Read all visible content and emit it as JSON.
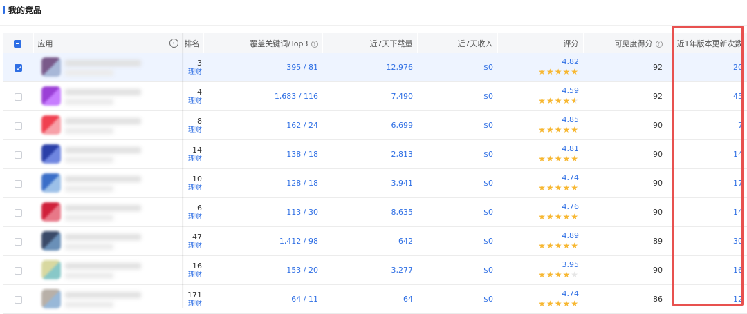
{
  "section": {
    "title": "我的竞品"
  },
  "columns": {
    "app": "应用",
    "rank": "排名",
    "keywords": "覆盖关键词/Top3",
    "downloads": "近7天下载量",
    "revenue": "近7天收入",
    "rating": "评分",
    "visibility": "可见度得分",
    "updates": "近1年版本更新次数"
  },
  "icons": {
    "collapse": "chevron-left-circle-icon",
    "help": "question-circle-icon",
    "star": "star-icon"
  },
  "colors": {
    "accent": "#2f6fe4",
    "star": "#f7b731",
    "highlight": "#e8514f"
  },
  "rows": [
    {
      "checked": true,
      "icon_colors": [
        "#7a5a8a",
        "#a8b8d8"
      ],
      "rank": "3",
      "category": "理财",
      "keywords": "395 / 81",
      "downloads": "12,976",
      "revenue": "$0",
      "rating": "4.82",
      "stars": 5,
      "visibility": "92",
      "updates": "20"
    },
    {
      "checked": false,
      "icon_colors": [
        "#9b3fd6",
        "#c77dff"
      ],
      "rank": "4",
      "category": "理财",
      "keywords": "1,683 / 116",
      "downloads": "7,490",
      "revenue": "$0",
      "rating": "4.59",
      "stars": 4.5,
      "visibility": "92",
      "updates": "45"
    },
    {
      "checked": false,
      "icon_colors": [
        "#f04050",
        "#f7a0a8"
      ],
      "rank": "8",
      "category": "理财",
      "keywords": "162 / 24",
      "downloads": "6,699",
      "revenue": "$0",
      "rating": "4.85",
      "stars": 5,
      "visibility": "90",
      "updates": "7"
    },
    {
      "checked": false,
      "icon_colors": [
        "#2a3fa8",
        "#6f86e0"
      ],
      "rank": "14",
      "category": "理财",
      "keywords": "138 / 18",
      "downloads": "2,813",
      "revenue": "$0",
      "rating": "4.81",
      "stars": 5,
      "visibility": "90",
      "updates": "14"
    },
    {
      "checked": false,
      "icon_colors": [
        "#3a6ec8",
        "#9cc0e8"
      ],
      "rank": "10",
      "category": "理财",
      "keywords": "128 / 18",
      "downloads": "3,941",
      "revenue": "$0",
      "rating": "4.74",
      "stars": 5,
      "visibility": "90",
      "updates": "17"
    },
    {
      "checked": false,
      "icon_colors": [
        "#d0203a",
        "#e87888"
      ],
      "rank": "6",
      "category": "理财",
      "keywords": "113 / 30",
      "downloads": "8,635",
      "revenue": "$0",
      "rating": "4.76",
      "stars": 5,
      "visibility": "90",
      "updates": "14"
    },
    {
      "checked": false,
      "icon_colors": [
        "#3a4a68",
        "#6a90b8"
      ],
      "rank": "47",
      "category": "理财",
      "keywords": "1,412 / 98",
      "downloads": "642",
      "revenue": "$0",
      "rating": "4.89",
      "stars": 5,
      "visibility": "89",
      "updates": "30"
    },
    {
      "checked": false,
      "icon_colors": [
        "#d8d8a0",
        "#88c8c8"
      ],
      "rank": "16",
      "category": "理财",
      "keywords": "153 / 20",
      "downloads": "3,277",
      "revenue": "$0",
      "rating": "3.95",
      "stars": 4,
      "visibility": "90",
      "updates": "16"
    },
    {
      "checked": false,
      "icon_colors": [
        "#b8b0a8",
        "#98b8d8"
      ],
      "rank": "171",
      "category": "理财",
      "keywords": "64 / 11",
      "downloads": "64",
      "revenue": "$0",
      "rating": "4.74",
      "stars": 5,
      "visibility": "86",
      "updates": "12"
    }
  ]
}
